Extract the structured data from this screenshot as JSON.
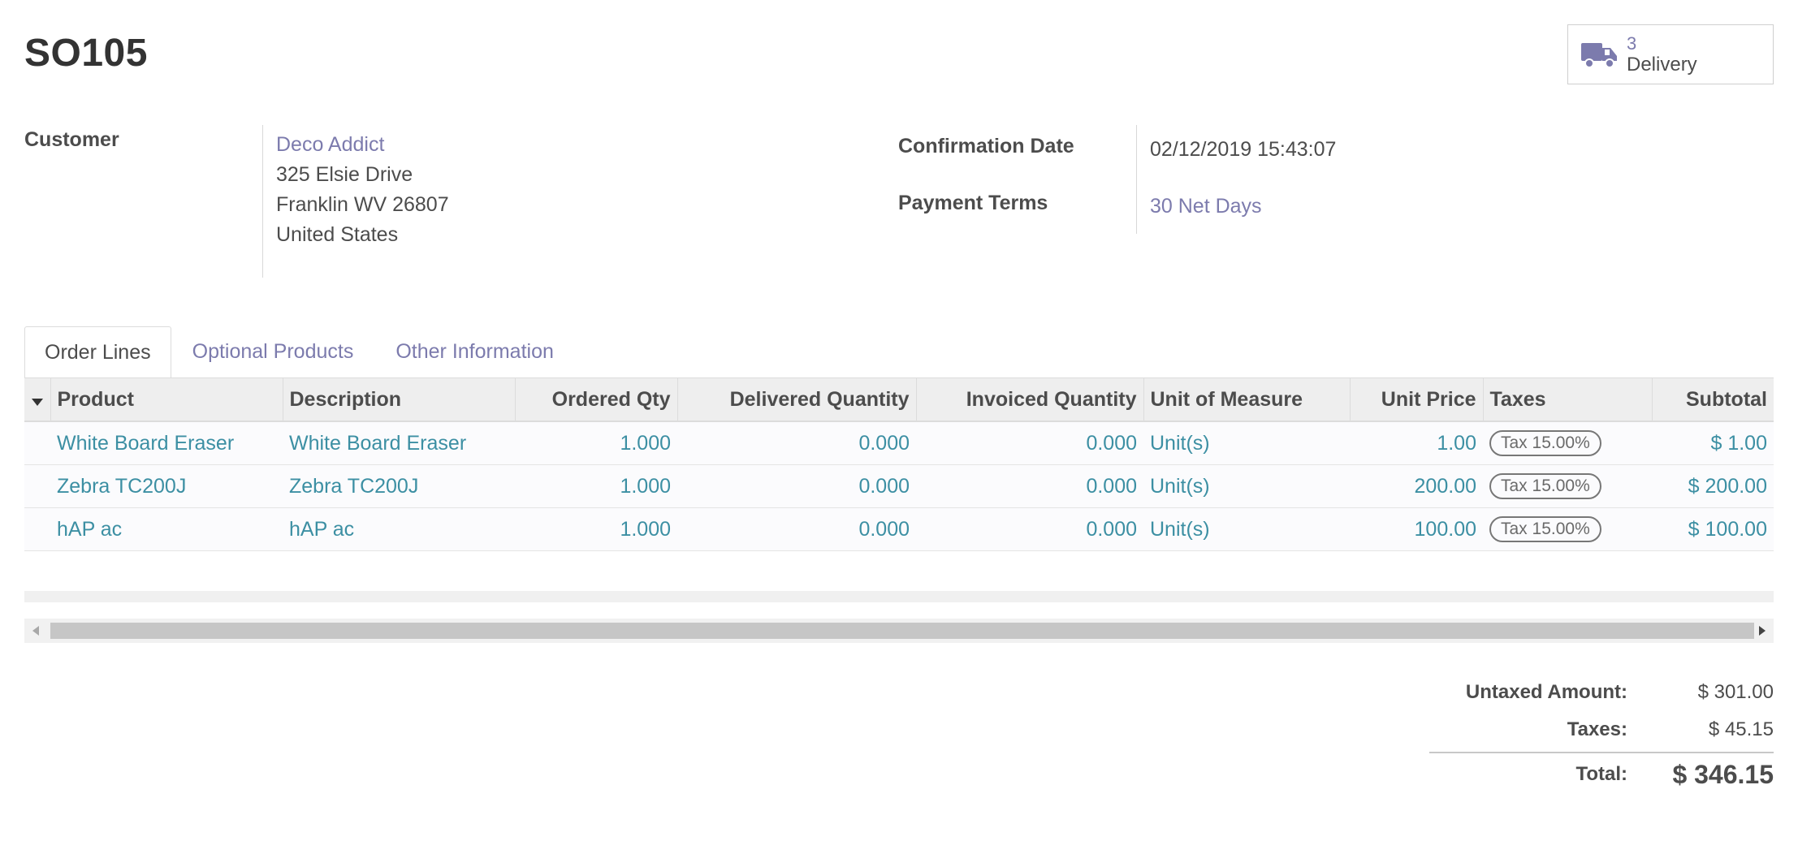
{
  "order": {
    "name": "SO105"
  },
  "smart_button": {
    "count": "3",
    "label": "Delivery",
    "icon": "truck-icon"
  },
  "customer": {
    "label": "Customer",
    "name": "Deco Addict",
    "street": "325 Elsie Drive",
    "city": "Franklin WV 26807",
    "country": "United States"
  },
  "confirmation": {
    "label": "Confirmation Date",
    "value": "02/12/2019 15:43:07"
  },
  "payment_terms": {
    "label": "Payment Terms",
    "value": "30 Net Days"
  },
  "tabs": [
    {
      "label": "Order Lines",
      "active": true
    },
    {
      "label": "Optional Products",
      "active": false
    },
    {
      "label": "Other Information",
      "active": false
    }
  ],
  "columns": {
    "product": "Product",
    "description": "Description",
    "ordered_qty": "Ordered Qty",
    "delivered_qty": "Delivered Quantity",
    "invoiced_qty": "Invoiced Quantity",
    "uom": "Unit of Measure",
    "unit_price": "Unit Price",
    "taxes": "Taxes",
    "subtotal": "Subtotal"
  },
  "lines": [
    {
      "product": "White Board Eraser",
      "description": "White Board Eraser",
      "ordered_qty": "1.000",
      "delivered_qty": "0.000",
      "invoiced_qty": "0.000",
      "uom": "Unit(s)",
      "unit_price": "1.00",
      "tax": "Tax 15.00%",
      "subtotal": "$ 1.00"
    },
    {
      "product": "Zebra TC200J",
      "description": "Zebra TC200J",
      "ordered_qty": "1.000",
      "delivered_qty": "0.000",
      "invoiced_qty": "0.000",
      "uom": "Unit(s)",
      "unit_price": "200.00",
      "tax": "Tax 15.00%",
      "subtotal": "$ 200.00"
    },
    {
      "product": "hAP ac",
      "description": "hAP ac",
      "ordered_qty": "1.000",
      "delivered_qty": "0.000",
      "invoiced_qty": "0.000",
      "uom": "Unit(s)",
      "unit_price": "100.00",
      "tax": "Tax 15.00%",
      "subtotal": "$ 100.00"
    }
  ],
  "totals": {
    "untaxed_label": "Untaxed Amount:",
    "untaxed_value": "$ 301.00",
    "taxes_label": "Taxes:",
    "taxes_value": "$ 45.15",
    "total_label": "Total:",
    "total_value": "$ 346.15"
  },
  "colors": {
    "link": "#7c7bad",
    "line_text": "#3c8fa3",
    "header_bg": "#eeeeee"
  }
}
